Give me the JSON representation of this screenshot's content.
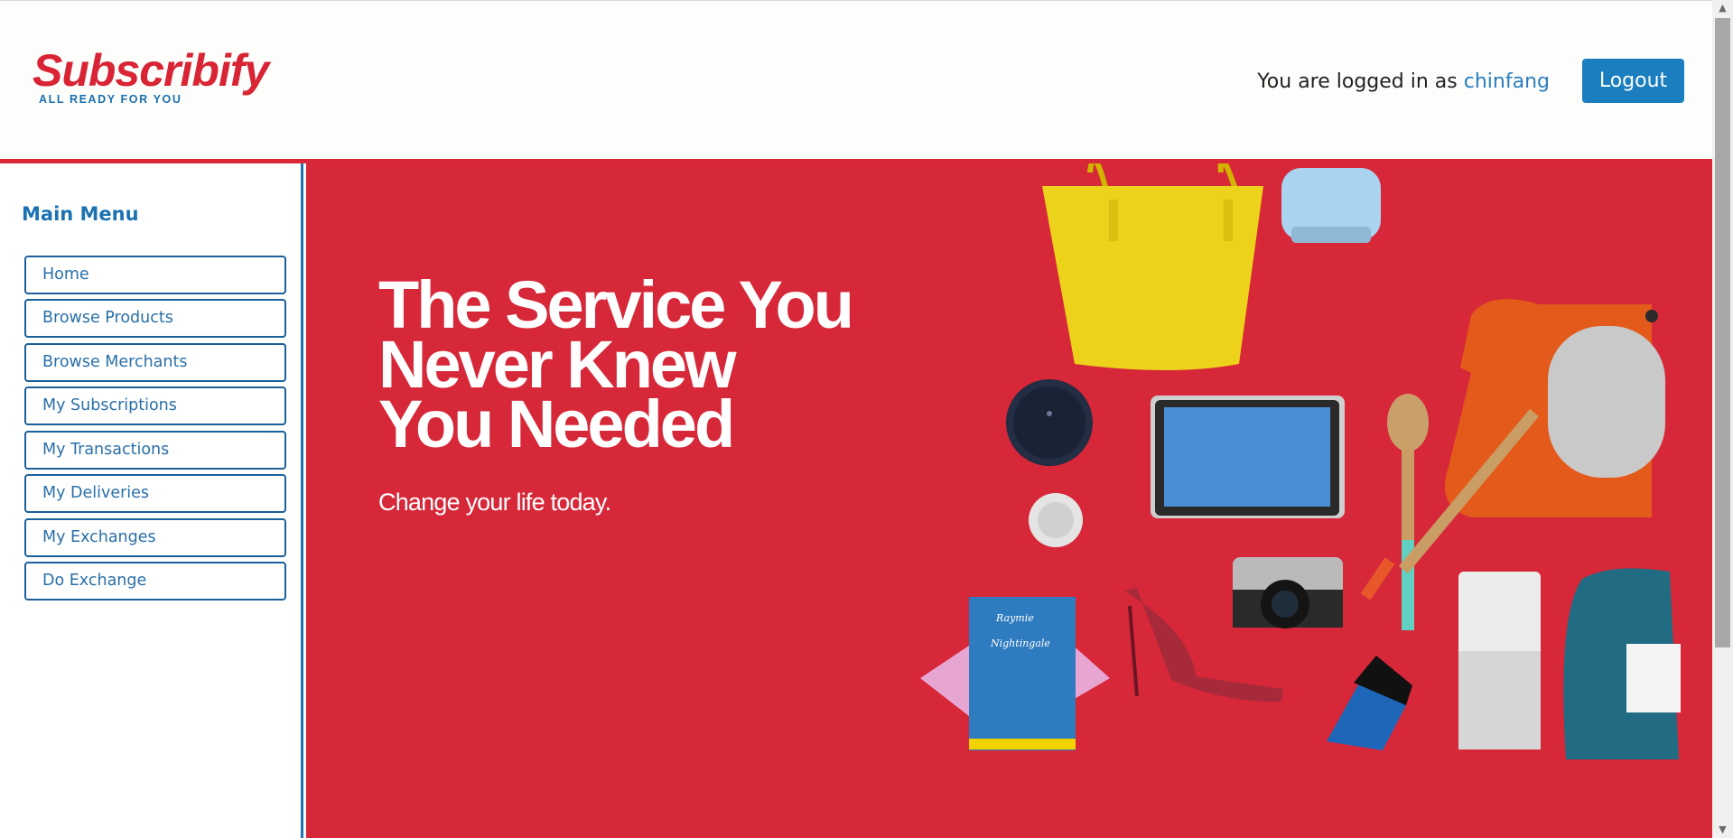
{
  "brand": {
    "name": "Subscribify",
    "tagline": "ALL READY FOR YOU",
    "red": "#d82434",
    "blue": "#1a6fae"
  },
  "header": {
    "login_prefix": "You are logged in as",
    "username": "chinfang",
    "logout_label": "Logout"
  },
  "sidebar": {
    "title": "Main Menu",
    "items": [
      {
        "label": "Home"
      },
      {
        "label": "Browse Products"
      },
      {
        "label": "Browse Merchants"
      },
      {
        "label": "My Subscriptions"
      },
      {
        "label": "My Transactions"
      },
      {
        "label": "My Deliveries"
      },
      {
        "label": "My Exchanges"
      },
      {
        "label": "Do Exchange"
      }
    ]
  },
  "hero": {
    "headline_line1": "The Service You",
    "headline_line2": "Never Knew",
    "headline_line3": "You Needed",
    "subline": "Change your life today.",
    "background": "#d62839",
    "book_title_line1": "Raymie",
    "book_title_line2": "Nightingale"
  },
  "icons": {
    "scroll_up": "arrow-up-icon",
    "scroll_down": "arrow-down-icon"
  }
}
